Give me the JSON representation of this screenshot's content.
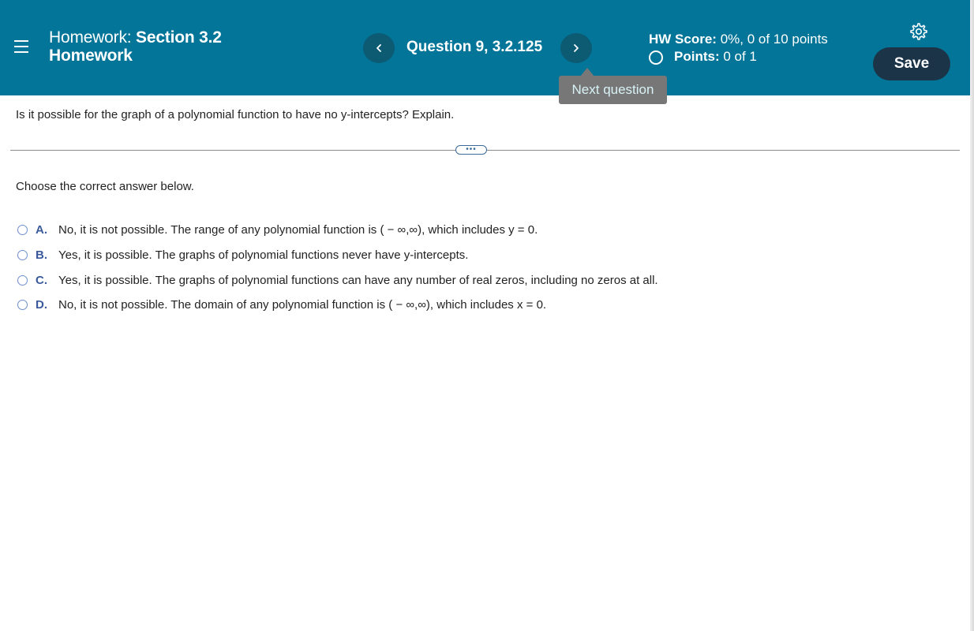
{
  "header": {
    "title_label": "Homework:",
    "title_bold_line1": "Section 3.2",
    "title_bold_line2": "Homework",
    "question_label": "Question 9, 3.2.125",
    "tooltip": "Next question",
    "hw_score_label": "HW Score:",
    "hw_score_value": "0%, 0 of 10 points",
    "points_label": "Points:",
    "points_value": "0 of 1",
    "save_label": "Save",
    "colors": {
      "bar": "#027599",
      "save_button": "#1c3448",
      "nav_button": "#0d5a73"
    },
    "icons": [
      "hamburger-menu-icon",
      "chevron-left-icon",
      "chevron-right-icon",
      "gear-icon",
      "circle-icon"
    ]
  },
  "question": {
    "text": "Is it possible for the graph of a polynomial function to have no y-intercepts? Explain.",
    "expand_label": "•••"
  },
  "answer": {
    "prompt": "Choose the correct answer below.",
    "options": [
      {
        "letter": "A.",
        "text": "No, it is not possible. The range of any polynomial function is ( − ∞,∞), which includes y = 0."
      },
      {
        "letter": "B.",
        "text": "Yes, it is possible. The graphs of polynomial functions never have y-intercepts."
      },
      {
        "letter": "C.",
        "text": "Yes, it is possible. The graphs of polynomial functions can have any number of real zeros, including no zeros at all."
      },
      {
        "letter": "D.",
        "text": "No, it is not possible. The domain of any polynomial function is ( − ∞,∞), which includes x = 0."
      }
    ]
  }
}
